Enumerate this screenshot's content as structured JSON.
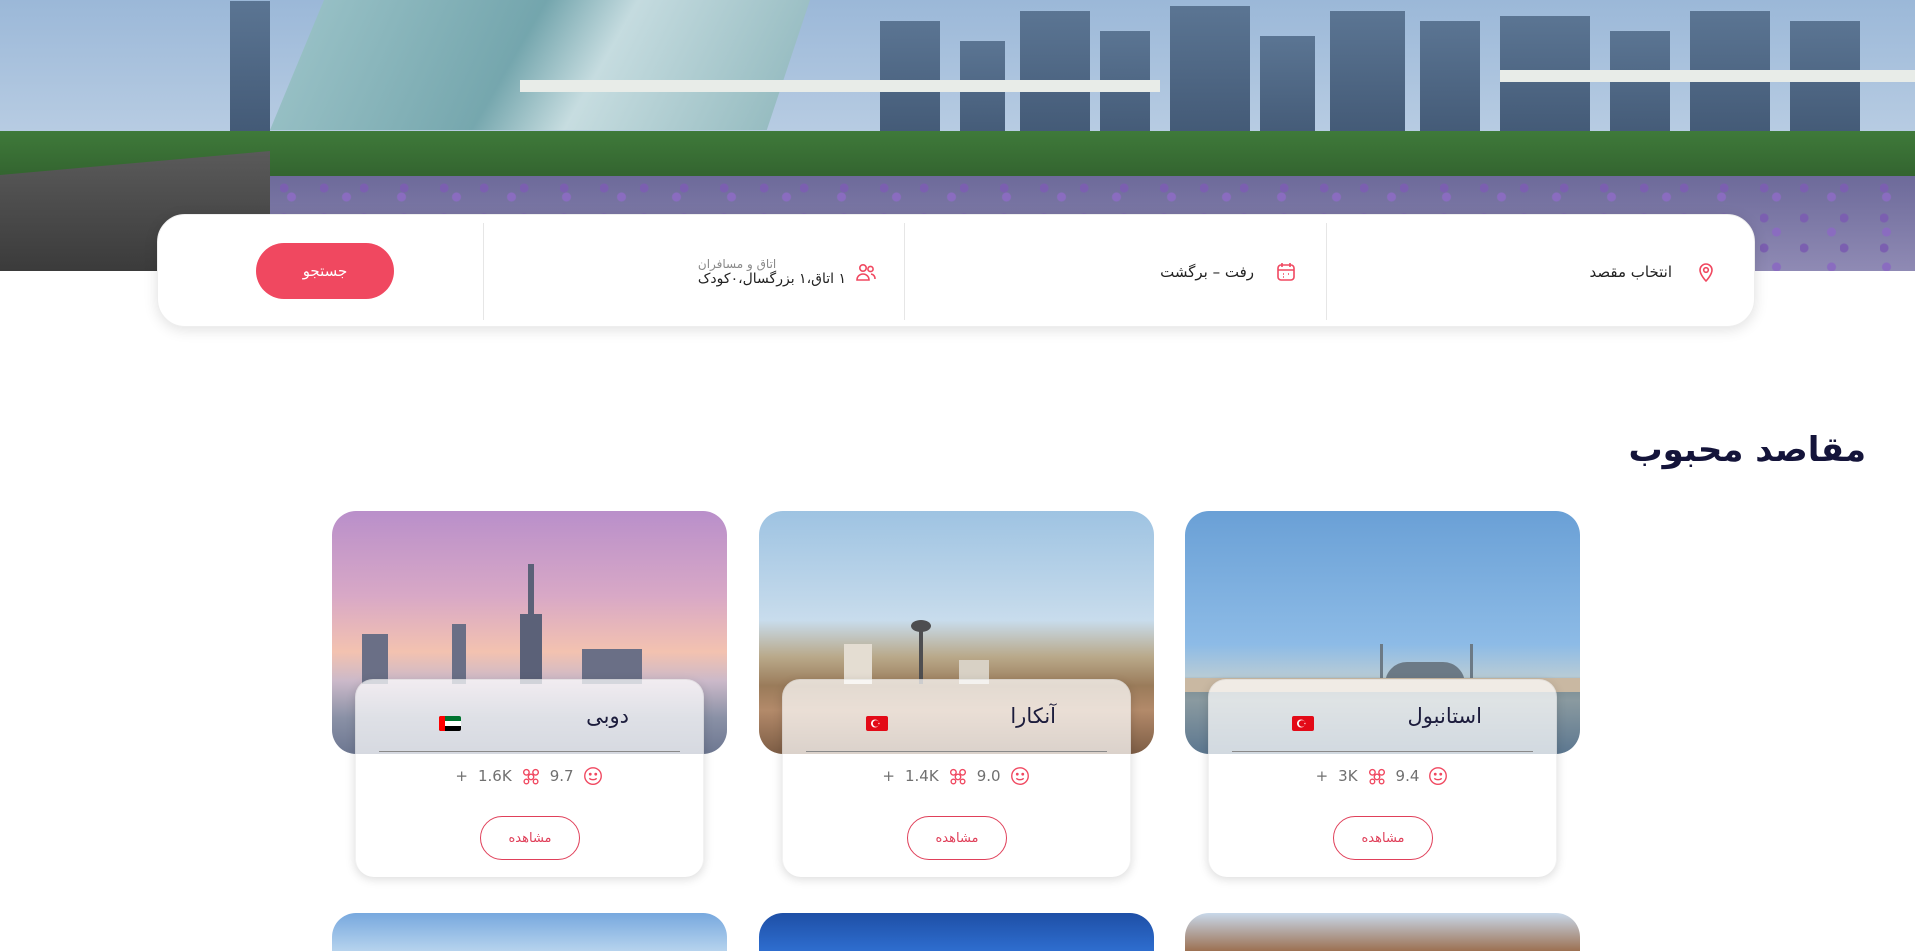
{
  "search": {
    "destination_label": "انتخاب مقصد",
    "dates_label": "رفت – برگشت",
    "guests_caption": "اتاق و مسافران",
    "guests_value": "۱ اتاق،۱ بزرگسال،۰کودک",
    "button_label": "جستجو"
  },
  "section": {
    "title": "مقاصد محبوب"
  },
  "cards": [
    {
      "city": "استانبول",
      "flag": "turkey-flag",
      "score": "9.4",
      "reviews": "3K",
      "plus": "+",
      "button": "مشاهده"
    },
    {
      "city": "آنکارا",
      "flag": "turkey-flag",
      "score": "9.0",
      "reviews": "1.4K",
      "plus": "+",
      "button": "مشاهده"
    },
    {
      "city": "دوبی",
      "flag": "uae-flag",
      "score": "9.7",
      "reviews": "1.6K",
      "plus": "+",
      "button": "مشاهده"
    }
  ],
  "colors": {
    "accent": "#f04860",
    "title": "#14143a"
  }
}
